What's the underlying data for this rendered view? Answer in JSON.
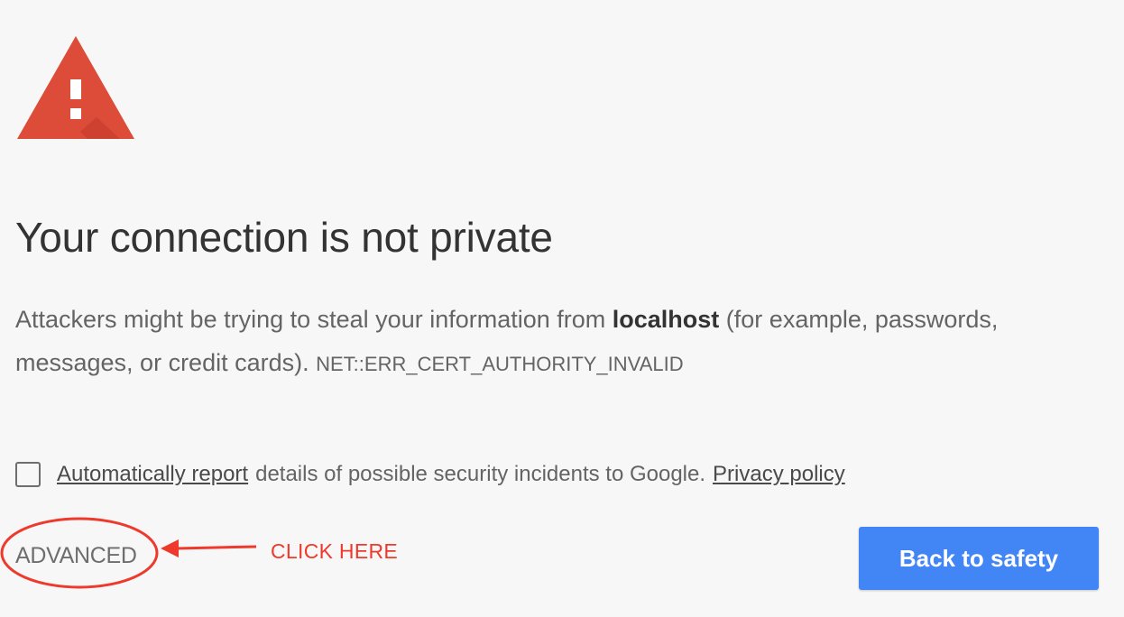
{
  "icons": {
    "warning": "warning-triangle-icon",
    "colors": {
      "triangle": "#dd4b39",
      "triangle_shadow": "#c53929",
      "exclamation": "#ffffff"
    }
  },
  "heading": {
    "title": "Your connection is not private"
  },
  "description": {
    "prefix": "Attackers might be trying to steal your information from ",
    "host": "localhost",
    "suffix": " (for example, passwords, messages, or credit cards). ",
    "error_code": "NET::ERR_CERT_AUTHORITY_INVALID"
  },
  "report": {
    "checked": false,
    "link_label": "Automatically report",
    "middle_text": "details of possible security incidents to Google.",
    "privacy_label": "Privacy policy"
  },
  "actions": {
    "advanced_label": "ADVANCED",
    "back_label": "Back to safety",
    "back_color": "#4285f4"
  },
  "annotation": {
    "label": "CLICK HERE",
    "color": "#ee3a2d"
  }
}
